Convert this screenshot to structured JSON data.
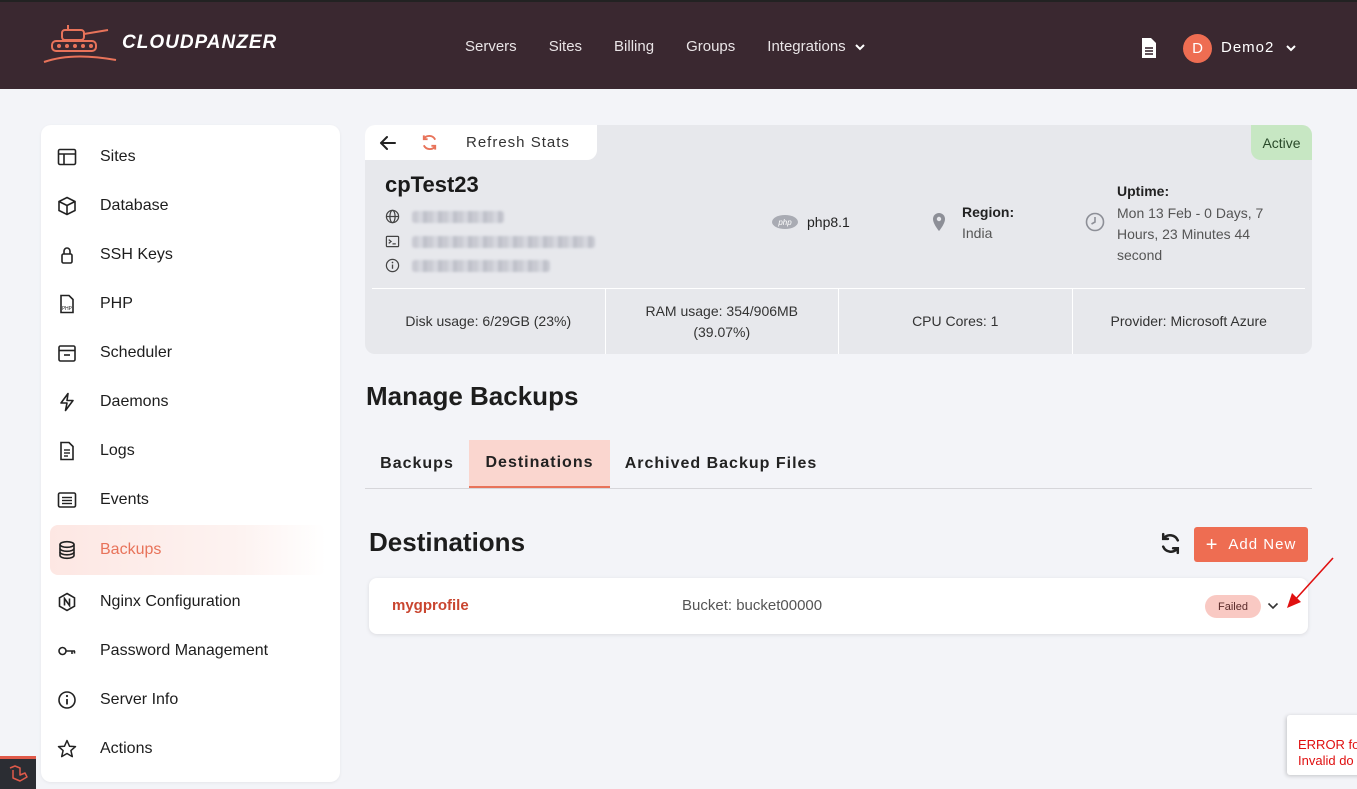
{
  "brand": {
    "name": "CLOUDPANZER"
  },
  "nav": {
    "items": [
      "Servers",
      "Sites",
      "Billing",
      "Groups",
      "Integrations"
    ]
  },
  "user": {
    "initial": "D",
    "name": "Demo2"
  },
  "sidebar": {
    "items": [
      {
        "label": "Sites",
        "icon": "layout-icon"
      },
      {
        "label": "Database",
        "icon": "cube-icon"
      },
      {
        "label": "SSH Keys",
        "icon": "lock-icon"
      },
      {
        "label": "PHP",
        "icon": "php-file-icon"
      },
      {
        "label": "Scheduler",
        "icon": "calendar-icon"
      },
      {
        "label": "Daemons",
        "icon": "bolt-icon"
      },
      {
        "label": "Logs",
        "icon": "file-text-icon"
      },
      {
        "label": "Events",
        "icon": "list-icon"
      },
      {
        "label": "Backups",
        "icon": "database-icon",
        "active": true
      },
      {
        "label": "Nginx Configuration",
        "icon": "nginx-icon"
      },
      {
        "label": "Password Management",
        "icon": "key-icon"
      },
      {
        "label": "Server Info",
        "icon": "info-icon"
      },
      {
        "label": "Actions",
        "icon": "star-icon"
      }
    ]
  },
  "server": {
    "refresh_label": "Refresh Stats",
    "status": "Active",
    "name": "cpTest23",
    "php": {
      "logo": "php",
      "version": "php8.1"
    },
    "region_label": "Region:",
    "region_value": "India",
    "uptime_label": "Uptime:",
    "uptime_value": "Mon 13 Feb - 0 Days, 7 Hours, 23 Minutes 44 second",
    "stats": [
      {
        "label": "Disk usage:",
        "value": "6/29GB (23%)"
      },
      {
        "label": "RAM usage:",
        "value": "354/906MB (39.07%)"
      },
      {
        "label": "CPU Cores:",
        "value": "1"
      },
      {
        "label": "Provider:",
        "value": "Microsoft Azure"
      }
    ]
  },
  "backups": {
    "title": "Manage Backups",
    "tabs": [
      "Backups",
      "Destinations",
      "Archived Backup Files"
    ],
    "active_tab": "Destinations",
    "section_title": "Destinations",
    "add_label": "Add New",
    "destinations": [
      {
        "name": "mygprofile",
        "bucket": "Bucket: bucket00000",
        "status": "Failed"
      }
    ]
  },
  "error_toast": {
    "line1": "ERROR fo",
    "line2": "Invalid do"
  },
  "colors": {
    "accent": "#ee6d52",
    "topbar": "#3a2830",
    "active_status": "#c7e7c3",
    "failed": "#f9c9c3"
  }
}
